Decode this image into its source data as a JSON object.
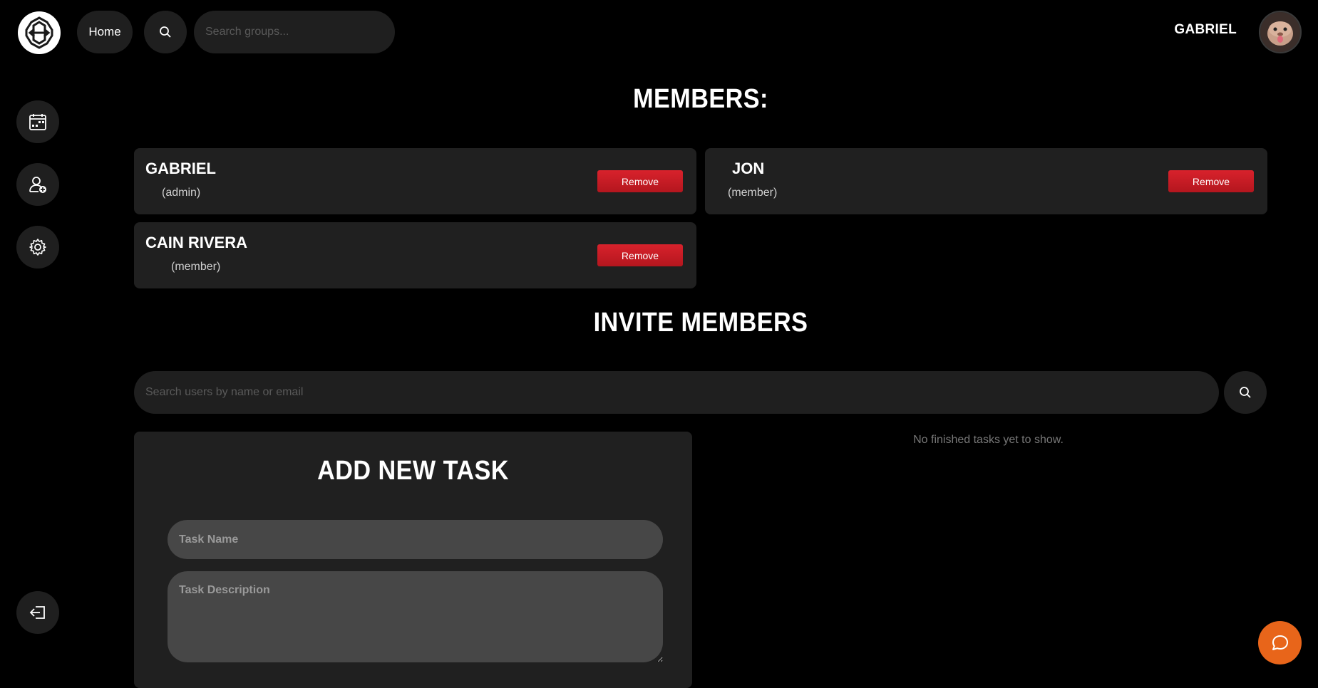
{
  "topbar": {
    "home_label": "Home",
    "search_groups_placeholder": "Search groups...",
    "user_name": "GABRIEL"
  },
  "members": {
    "title": "MEMBERS:",
    "list": [
      {
        "name": "GABRIEL",
        "role": "(admin)",
        "remove_label": "Remove"
      },
      {
        "name": "JON",
        "role": "(member)",
        "remove_label": "Remove"
      },
      {
        "name": "CAIN RIVERA",
        "role": "(member)",
        "remove_label": "Remove"
      }
    ]
  },
  "invite": {
    "title": "INVITE MEMBERS",
    "search_placeholder": "Search users by name or email"
  },
  "task_form": {
    "title": "ADD NEW TASK",
    "name_placeholder": "Task Name",
    "description_placeholder": "Task Description"
  },
  "finished_tasks": {
    "empty_text": "No finished tasks yet to show."
  },
  "colors": {
    "background": "#000000",
    "card": "#202020",
    "remove_button": "#c81e26",
    "chat_button": "#e8651a"
  },
  "icons": {
    "logo": "app-logo-icon",
    "search": "search-icon",
    "calendar": "calendar-icon",
    "add_user": "add-user-icon",
    "settings": "gear-icon",
    "logout": "logout-icon",
    "chat": "chat-bubble-icon"
  }
}
